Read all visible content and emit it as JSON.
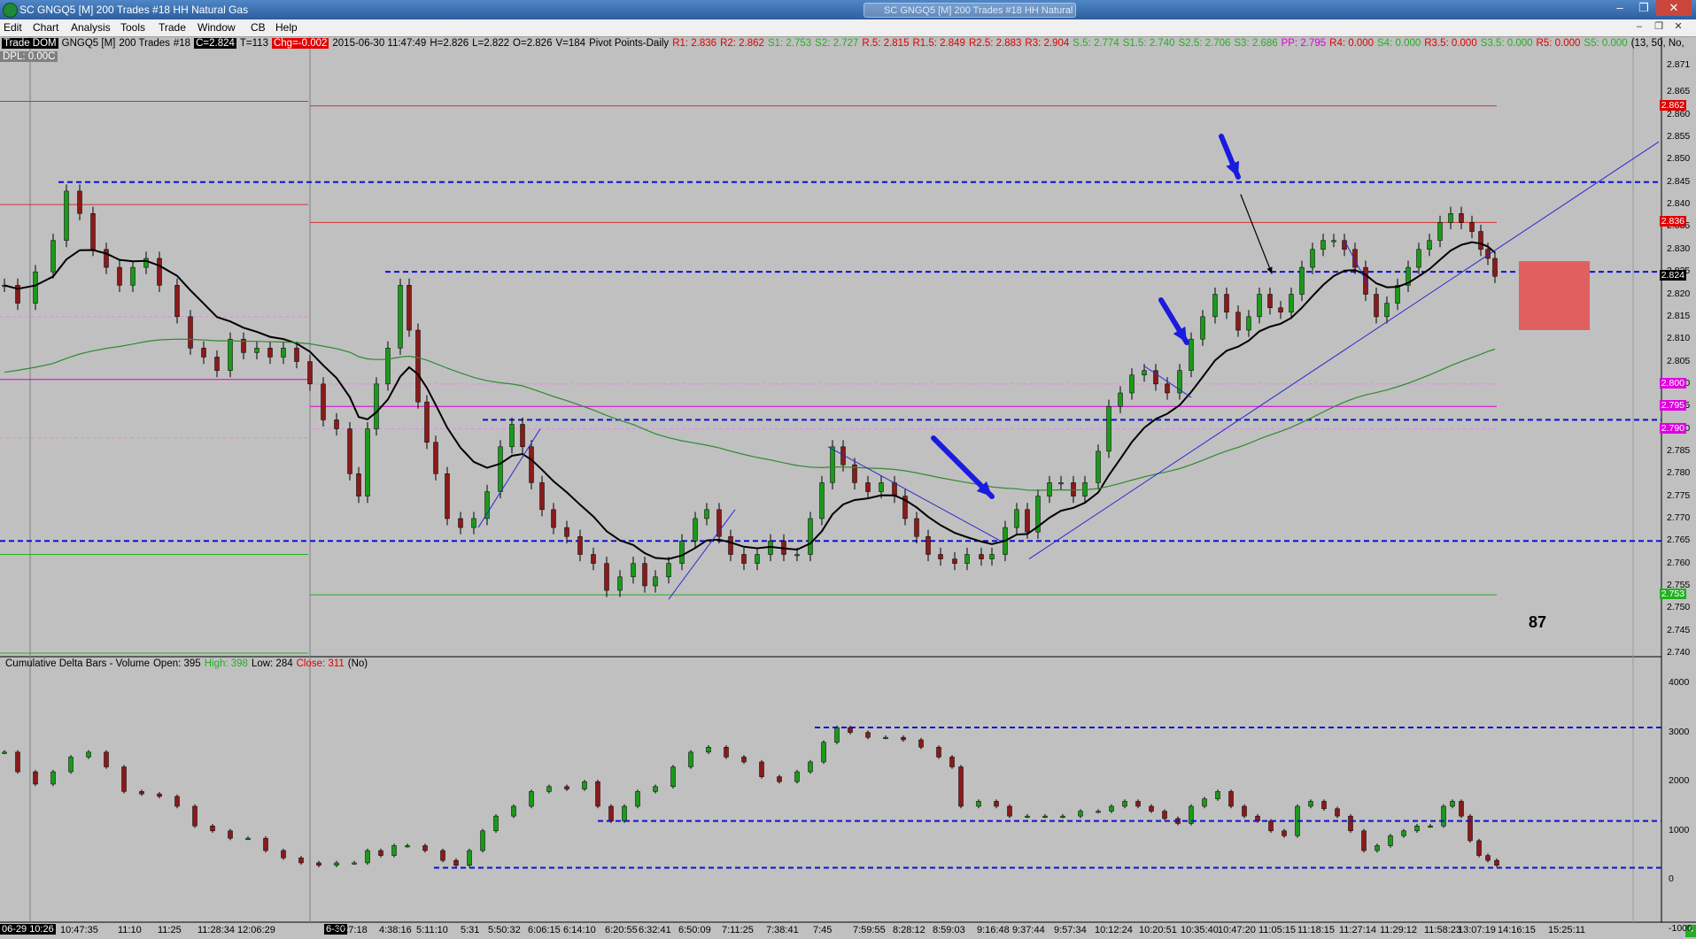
{
  "window": {
    "title": "SC GNGQ5 [M]  200 Trades  #18  HH Natural Gas",
    "ghost_tab": "SC GNGQ5 [M]  200 Trades  #18  HH Natural Gas"
  },
  "menu": {
    "items": [
      "Edit",
      "Chart",
      "Analysis",
      "Tools",
      "Trade",
      "Window",
      "CB",
      "Help"
    ]
  },
  "info": {
    "prefix": "Trade DOM",
    "symbol": "GNGQ5 [M]",
    "bars": "200 Trades",
    "num": "#18",
    "close": "C=2.824",
    "t": "T=113",
    "chg": "Chg=-0.002",
    "datetime": "2015-06-30 11:47:49",
    "h": "H=2.826",
    "l": "L=2.822",
    "o": "O=2.826",
    "v": "V=184",
    "pivot_label": "Pivot Points-Daily",
    "r1": "R1: 2.836",
    "r2": "R2: 2.862",
    "s1": "S1: 2.753",
    "s2": "S2: 2.727",
    "r05": "R.5: 2.815",
    "r15": "R1.5: 2.849",
    "r25": "R2.5: 2.883",
    "r3": "R3: 2.904",
    "s05": "S.5: 2.774",
    "s15": "S1.5: 2.740",
    "s25": "S2.5: 2.706",
    "s3": "S3: 2.686",
    "pp": "PP: 2.795",
    "r4": "R4: 0.000",
    "s4": "S4: 0.000",
    "r35": "R3.5: 0.000",
    "s35": "S3.5: 0.000",
    "r5": "R5: 0.000",
    "s5": "S5: 0.000",
    "params": "(13, 50, No,",
    "dpl": "DPL: 0.00C"
  },
  "subgraph": {
    "title": "Cumulative Delta Bars - Volume",
    "open": "Open: 395",
    "high": "High: 398",
    "low": "Low: 284",
    "close": "Close: 311",
    "flag": "(No)"
  },
  "price_axis": {
    "labels": [
      "2.871",
      "2.865",
      "2.860",
      "2.855",
      "2.850",
      "2.845",
      "2.840",
      "2.835",
      "2.830",
      "2.825",
      "2.820",
      "2.815",
      "2.810",
      "2.805",
      "2.800",
      "2.795",
      "2.790",
      "2.785",
      "2.780",
      "2.775",
      "2.770",
      "2.765",
      "2.760",
      "2.755",
      "2.750",
      "2.745",
      "2.740"
    ],
    "boxes": [
      {
        "text": "2.862",
        "color": "#e00000"
      },
      {
        "text": "2.836",
        "color": "#e00000"
      },
      {
        "text": "2.824",
        "color": "#000000"
      },
      {
        "text": "2.800",
        "color": "#e000e0"
      },
      {
        "text": "2.795",
        "color": "#e000e0"
      },
      {
        "text": "2.790",
        "color": "#e000e0"
      },
      {
        "text": "2.753",
        "color": "#22b022"
      }
    ]
  },
  "volume_axis": {
    "labels": [
      "4000",
      "3000",
      "2000",
      "1000",
      "0",
      "-1000"
    ]
  },
  "time_axis": {
    "pill1": "06-29 10:26",
    "pill2": "6-30",
    "labels": [
      "10:47:35",
      "11:10",
      "11:25",
      "11:28:34",
      "12:06:29",
      "3:27:18",
      "4:38:16",
      "5:11:10",
      "5:31",
      "5:50:32",
      "6:06:15",
      "6:14:10",
      "6:20:55",
      "6:32:41",
      "6:50:09",
      "7:11:25",
      "7:38:41",
      "7:45",
      "7:59:55",
      "8:28:12",
      "8:59:03",
      "9:16:48",
      "9:37:44",
      "9:57:34",
      "10:12:24",
      "10:20:51",
      "10:35:40",
      "10:47:20",
      "11:05:15",
      "11:18:15",
      "11:27:14",
      "11:29:12",
      "11:58:23",
      "13:07:19",
      "14:16:15",
      "15:25:11"
    ],
    "corner": "4"
  },
  "annotation": {
    "number": "87"
  },
  "chart_data": {
    "type": "candlestick",
    "price_range": [
      2.74,
      2.871
    ],
    "volume_range": [
      -1000,
      4000
    ],
    "last_price": 2.824,
    "pivot_levels": {
      "R1": 2.836,
      "R2": 2.862,
      "S1": 2.753,
      "PP": 2.795
    },
    "horizontal_levels": [
      2.845,
      2.825,
      2.792,
      2.765
    ],
    "delta_levels": [
      3100,
      1200,
      250
    ]
  }
}
